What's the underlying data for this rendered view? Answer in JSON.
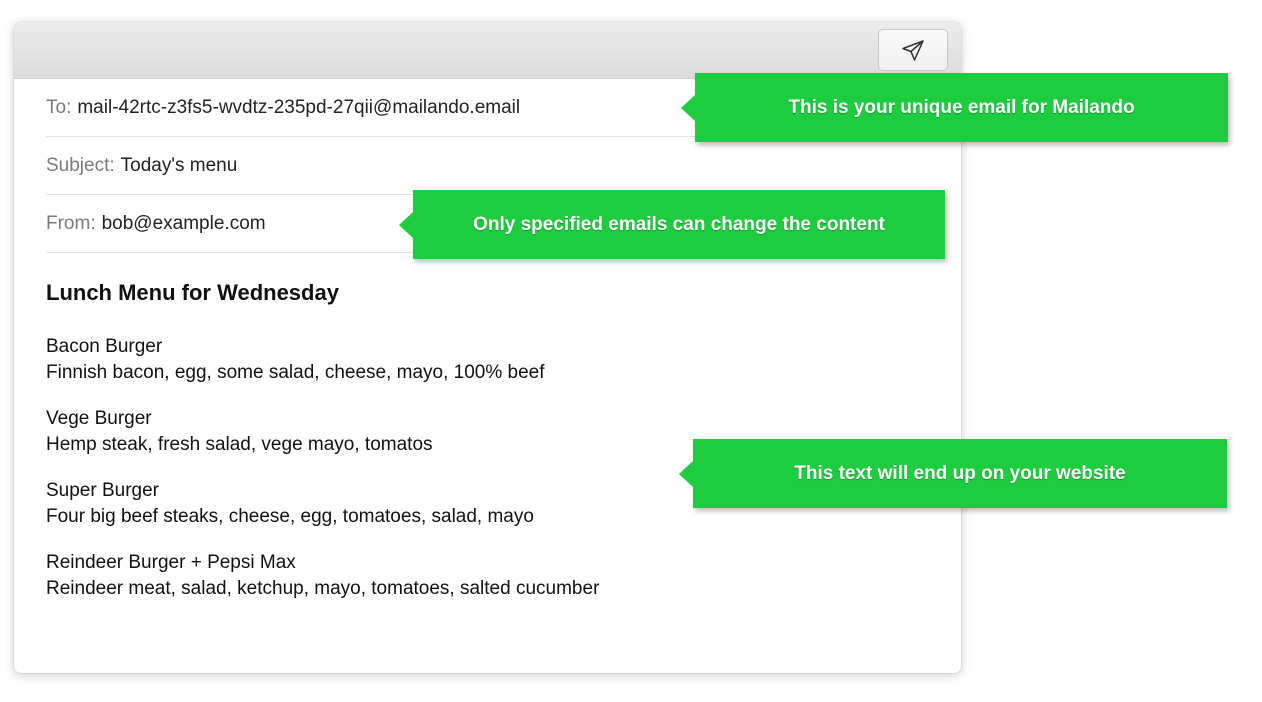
{
  "toolbar": {
    "send_icon": "paper-plane-icon"
  },
  "headers": {
    "to_label": "To:",
    "to_value": "mail-42rtc-z3fs5-wvdtz-235pd-27qii@mailando.email",
    "subject_label": "Subject:",
    "subject_value": "Today's menu",
    "from_label": "From:",
    "from_value": "bob@example.com"
  },
  "body": {
    "title": "Lunch Menu for Wednesday",
    "items": [
      {
        "name": "Bacon Burger",
        "description": "Finnish bacon, egg, some salad, cheese, mayo, 100% beef"
      },
      {
        "name": "Vege Burger",
        "description": "Hemp steak, fresh salad, vege mayo, tomatos"
      },
      {
        "name": "Super Burger",
        "description": "Four big beef steaks, cheese, egg, tomatoes, salad, mayo"
      },
      {
        "name": "Reindeer Burger + Pepsi Max",
        "description": "Reindeer meat, salad, ketchup, mayo, tomatoes, salted cucumber"
      }
    ]
  },
  "callouts": {
    "email": "This is your unique email for Mailando",
    "from": "Only specified emails can change the content",
    "text": "This text will end up on your website"
  },
  "colors": {
    "callout_green": "#1dcc3f"
  }
}
